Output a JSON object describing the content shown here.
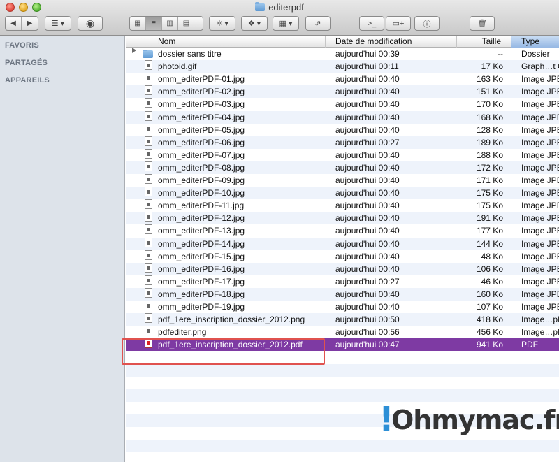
{
  "window": {
    "title": "editerpdf"
  },
  "toolbar": {
    "back_icon": "chevron-left-icon",
    "forward_icon": "chevron-right-icon",
    "arrange_icon": "list-menu-icon",
    "quicklook_icon": "eye-icon",
    "view_modes": [
      "icon-view-icon",
      "list-view-icon",
      "column-view-icon",
      "coverflow-view-icon"
    ],
    "active_view": 1
  },
  "sidebar": {
    "sections": [
      "FAVORIS",
      "PARTAGÉS",
      "APPAREILS"
    ]
  },
  "columns": {
    "name": "Nom",
    "date": "Date de modification",
    "size": "Taille",
    "type": "Type"
  },
  "files": [
    {
      "name": "dossier sans titre",
      "date": "aujourd'hui 00:39",
      "size": "--",
      "type": "Dossier",
      "kind": "folder"
    },
    {
      "name": "photoid.gif",
      "date": "aujourd'hui 00:11",
      "size": "17 Ko",
      "type": "Graph…t GIF",
      "kind": "image"
    },
    {
      "name": "omm_editerPDF-01.jpg",
      "date": "aujourd'hui 00:40",
      "size": "163 Ko",
      "type": "Image JPEG",
      "kind": "image"
    },
    {
      "name": "omm_editerPDF-02.jpg",
      "date": "aujourd'hui 00:40",
      "size": "151 Ko",
      "type": "Image JPEG",
      "kind": "image"
    },
    {
      "name": "omm_editerPDF-03.jpg",
      "date": "aujourd'hui 00:40",
      "size": "170 Ko",
      "type": "Image JPEG",
      "kind": "image"
    },
    {
      "name": "omm_editerPDF-04.jpg",
      "date": "aujourd'hui 00:40",
      "size": "168 Ko",
      "type": "Image JPEG",
      "kind": "image"
    },
    {
      "name": "omm_editerPDF-05.jpg",
      "date": "aujourd'hui 00:40",
      "size": "128 Ko",
      "type": "Image JPEG",
      "kind": "image"
    },
    {
      "name": "omm_editerPDF-06.jpg",
      "date": "aujourd'hui 00:27",
      "size": "189 Ko",
      "type": "Image JPEG",
      "kind": "image"
    },
    {
      "name": "omm_editerPDF-07.jpg",
      "date": "aujourd'hui 00:40",
      "size": "188 Ko",
      "type": "Image JPEG",
      "kind": "image"
    },
    {
      "name": "omm_editerPDF-08.jpg",
      "date": "aujourd'hui 00:40",
      "size": "172 Ko",
      "type": "Image JPEG",
      "kind": "image"
    },
    {
      "name": "omm_editerPDF-09.jpg",
      "date": "aujourd'hui 00:40",
      "size": "171 Ko",
      "type": "Image JPEG",
      "kind": "image"
    },
    {
      "name": "omm_editerPDF-10.jpg",
      "date": "aujourd'hui 00:40",
      "size": "175 Ko",
      "type": "Image JPEG",
      "kind": "image"
    },
    {
      "name": "omm_editerPDF-11.jpg",
      "date": "aujourd'hui 00:40",
      "size": "175 Ko",
      "type": "Image JPEG",
      "kind": "image"
    },
    {
      "name": "omm_editerPDF-12.jpg",
      "date": "aujourd'hui 00:40",
      "size": "191 Ko",
      "type": "Image JPEG",
      "kind": "image"
    },
    {
      "name": "omm_editerPDF-13.jpg",
      "date": "aujourd'hui 00:40",
      "size": "177 Ko",
      "type": "Image JPEG",
      "kind": "image"
    },
    {
      "name": "omm_editerPDF-14.jpg",
      "date": "aujourd'hui 00:40",
      "size": "144 Ko",
      "type": "Image JPEG",
      "kind": "image"
    },
    {
      "name": "omm_editerPDF-15.jpg",
      "date": "aujourd'hui 00:40",
      "size": "48 Ko",
      "type": "Image JPEG",
      "kind": "image"
    },
    {
      "name": "omm_editerPDF-16.jpg",
      "date": "aujourd'hui 00:40",
      "size": "106 Ko",
      "type": "Image JPEG",
      "kind": "image"
    },
    {
      "name": "omm_editerPDF-17.jpg",
      "date": "aujourd'hui 00:27",
      "size": "46 Ko",
      "type": "Image JPEG",
      "kind": "image"
    },
    {
      "name": "omm_editerPDF-18.jpg",
      "date": "aujourd'hui 00:40",
      "size": "160 Ko",
      "type": "Image JPEG",
      "kind": "image"
    },
    {
      "name": "omm_editerPDF-19.jpg",
      "date": "aujourd'hui 00:40",
      "size": "107 Ko",
      "type": "Image JPEG",
      "kind": "image"
    },
    {
      "name": "pdf_1ere_inscription_dossier_2012.png",
      "date": "aujourd'hui 00:50",
      "size": "418 Ko",
      "type": "Image…pl PNG",
      "kind": "image"
    },
    {
      "name": "pdfediter.png",
      "date": "aujourd'hui 00:56",
      "size": "456 Ko",
      "type": "Image…pl PNG",
      "kind": "image"
    },
    {
      "name": "pdf_1ere_inscription_dossier_2012.pdf",
      "date": "aujourd'hui 00:47",
      "size": "941 Ko",
      "type": "PDF",
      "kind": "pdf",
      "selected": true
    }
  ],
  "watermark": {
    "bang": "!",
    "text": "Ohmymac.fr"
  },
  "colors": {
    "selection": "#7e3aa3",
    "highlight_box": "#e0524f",
    "sidebar": "#dde3ea"
  }
}
